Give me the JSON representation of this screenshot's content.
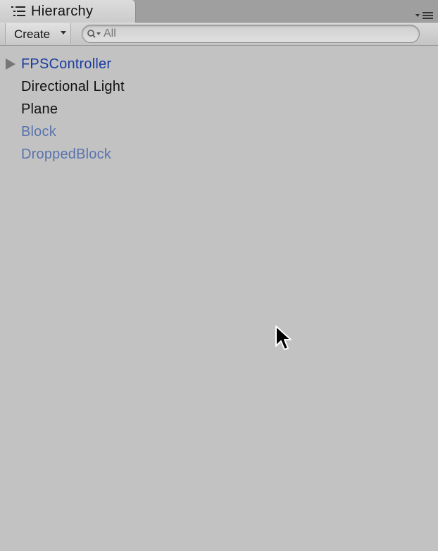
{
  "tab": {
    "title": "Hierarchy",
    "icon": "hierarchy-list-icon"
  },
  "toolbar": {
    "create_label": "Create",
    "search_placeholder": "All",
    "search_value": ""
  },
  "items": [
    {
      "label": "FPSController",
      "color": "#1a3d9e",
      "has_children": true,
      "kind": "prefab"
    },
    {
      "label": "Directional Light",
      "color": "#111111",
      "has_children": false,
      "kind": "object"
    },
    {
      "label": "Plane",
      "color": "#111111",
      "has_children": false,
      "kind": "object"
    },
    {
      "label": "Block",
      "color": "#5a73ad",
      "has_children": false,
      "kind": "prefab-broken"
    },
    {
      "label": "DroppedBlock",
      "color": "#5a73ad",
      "has_children": false,
      "kind": "prefab-broken"
    }
  ],
  "colors": {
    "panel_bg": "#c2c2c2",
    "prefab_text": "#1a3d9e",
    "disconnected_prefab_text": "#5a73ad",
    "normal_text": "#111111"
  }
}
